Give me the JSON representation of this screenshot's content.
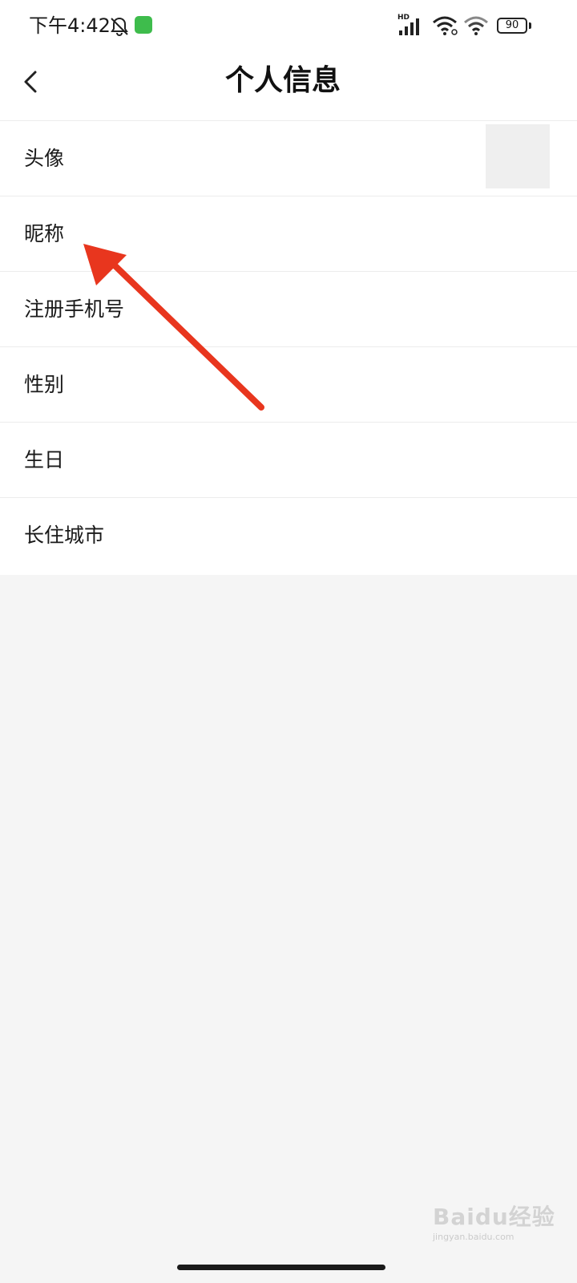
{
  "status_bar": {
    "time": "下午4:42",
    "network_label": "HD",
    "battery": "90",
    "icons": [
      "bell-off-icon",
      "app-notification-icon",
      "signal-icon",
      "wifi-link-icon",
      "wifi-icon",
      "battery-icon"
    ]
  },
  "header": {
    "title": "个人信息",
    "back_icon": "chevron-left-icon"
  },
  "list": {
    "items": [
      {
        "label": "头像"
      },
      {
        "label": "昵称"
      },
      {
        "label": "注册手机号"
      },
      {
        "label": "性别"
      },
      {
        "label": "生日"
      },
      {
        "label": "长住城市"
      }
    ]
  },
  "annotation": {
    "type": "arrow",
    "color": "#e8361e",
    "points_to": "昵称"
  },
  "watermark": {
    "brand": "Baidu经验",
    "url": "jingyan.baidu.com"
  },
  "colors": {
    "background": "#f5f5f5",
    "surface": "#ffffff",
    "divider": "#ececec",
    "text": "#1a1a1a"
  }
}
